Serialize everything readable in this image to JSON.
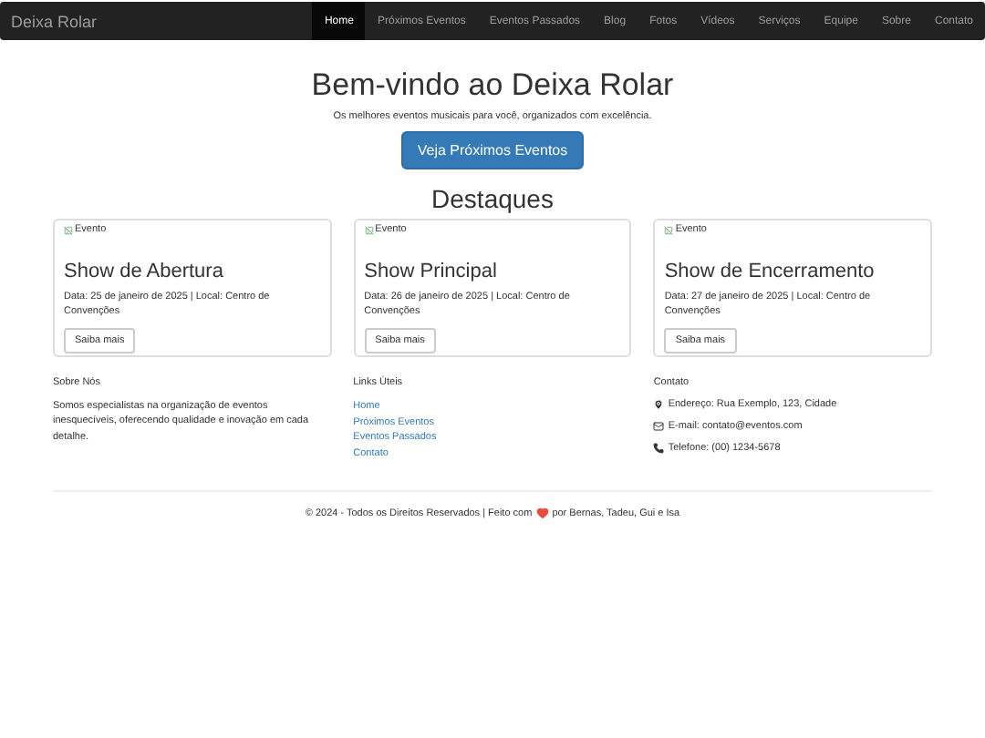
{
  "navbar": {
    "brand": "Deixa Rolar",
    "items": [
      {
        "label": "Home",
        "selected": true
      },
      {
        "label": "Próximos Eventos",
        "selected": false
      },
      {
        "label": "Eventos Passados",
        "selected": false
      },
      {
        "label": "Blog",
        "selected": false
      },
      {
        "label": "Fotos",
        "selected": false
      },
      {
        "label": "Vídeos",
        "selected": false
      },
      {
        "label": "Serviços",
        "selected": false
      },
      {
        "label": "Equipe",
        "selected": false
      },
      {
        "label": "Sobre",
        "selected": false
      },
      {
        "label": "Contato",
        "selected": false
      }
    ]
  },
  "hero": {
    "title": "Bem-vindo ao Deixa Rolar",
    "subtitle": "Os melhores eventos musicais para você, organizados com excelência.",
    "button": "Veja Próximos Eventos"
  },
  "highlights": {
    "title": "Destaques",
    "cards": [
      {
        "image_alt": "Evento",
        "title": "Show de Abertura",
        "text": "Data: 25 de janeiro de 2025 | Local: Centro de Convenções",
        "button": "Saiba mais"
      },
      {
        "image_alt": "Evento",
        "title": "Show Principal",
        "text": "Data: 26 de janeiro de 2025 | Local: Centro de Convenções",
        "button": "Saiba mais"
      },
      {
        "image_alt": "Evento",
        "title": "Show de Encerramento",
        "text": "Data: 27 de janeiro de 2025 | Local: Centro de Convenções",
        "button": "Saiba mais"
      }
    ]
  },
  "footer": {
    "about": {
      "title": "Sobre Nós",
      "text": "Somos especialistas na organização de eventos inesquecíveis, oferecendo qualidade e inovação em cada detalhe."
    },
    "links": {
      "title": "Links Úteis",
      "items": [
        "Home",
        "Próximos Eventos",
        "Eventos Passados",
        "Contato"
      ]
    },
    "contact": {
      "title": "Contato",
      "items": [
        {
          "kind": "address",
          "text": "Endereço: Rua Exemplo, 123, Cidade"
        },
        {
          "kind": "email",
          "text": "E-mail: contato@eventos.com"
        },
        {
          "kind": "phone",
          "text": "Telefone: (00) 1234-5678"
        }
      ]
    },
    "copyright_before": "© 2024 - Todos os Direitos Reservados | Feito com",
    "copyright_after": "por Bernas, Tadeu, Gui e Isa"
  }
}
